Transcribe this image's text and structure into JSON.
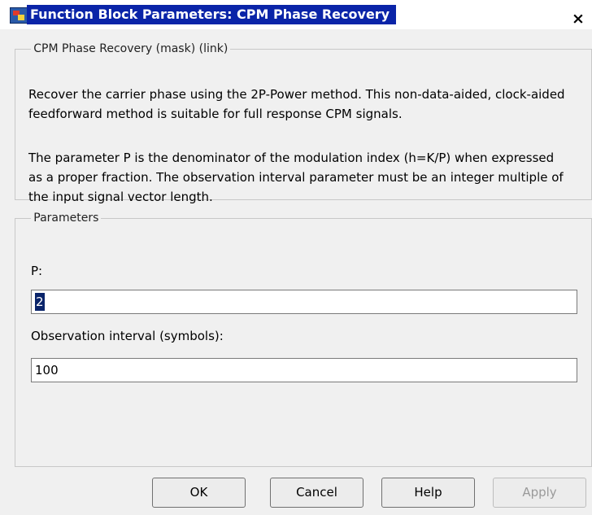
{
  "window": {
    "title": "Function Block Parameters: CPM Phase Recovery",
    "close_symbol": "×"
  },
  "description": {
    "legend": "CPM Phase Recovery (mask) (link)",
    "text1": "Recover the carrier phase using the 2P-Power method.  This non-data-aided, clock-aided feedforward method is suitable for full response CPM signals.",
    "text2": "The parameter P is the denominator of the modulation index (h=K/P) when expressed as a proper fraction. The observation interval parameter must be an integer multiple of the input signal vector length."
  },
  "parameters": {
    "legend": "Parameters",
    "p_label": "P:",
    "p_value": "2",
    "obs_label": "Observation interval (symbols):",
    "obs_value": "100"
  },
  "buttons": {
    "ok": "OK",
    "cancel": "Cancel",
    "help": "Help",
    "apply": "Apply"
  },
  "icons": {
    "app_icon": "simulink-block-icon",
    "close_icon": "close-icon"
  }
}
